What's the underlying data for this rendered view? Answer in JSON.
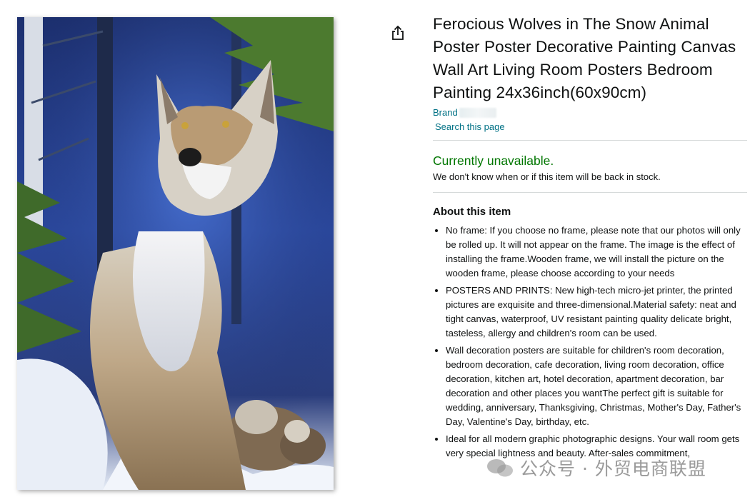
{
  "product": {
    "title": "Ferocious Wolves in The Snow Animal Poster Poster Decorative Painting Canvas Wall Art Living Room Posters Bedroom Painting 24x36inch(60x90cm)",
    "brand_label": "Brand",
    "search_link": "Search this page",
    "share_icon": "share-icon"
  },
  "availability": {
    "status": "Currently unavailable.",
    "note": "We don't know when or if this item will be back in stock.",
    "status_color": "#007600"
  },
  "about": {
    "heading": "About this item",
    "bullets": [
      "No frame: If you choose no frame, please note that our photos will only be rolled up. It will not appear on the frame. The image is the effect of installing the frame.Wooden frame, we will install the picture on the wooden frame, please choose according to your needs",
      "POSTERS AND PRINTS: New high-tech micro-jet printer, the printed pictures are exquisite and three-dimensional.Material safety: neat and tight canvas, waterproof, UV resistant painting quality delicate bright, tasteless, allergy and children's room can be used.",
      "Wall decoration posters are suitable for children's room decoration, bedroom decoration, cafe decoration, living room decoration, office decoration, kitchen art, hotel decoration, apartment decoration, bar decoration and other places you wantThe perfect gift is suitable for wedding, anniversary, Thanksgiving, Christmas, Mother's Day, Father's Day, Valentine's Day, birthday, etc.",
      "Ideal for all modern graphic photographic designs. Your wall room gets very special lightness and beauty. After-sales commitment,"
    ]
  },
  "watermark": {
    "text": "公众号 · 外贸电商联盟"
  },
  "colors": {
    "link": "#007185",
    "text": "#0f1111",
    "divider": "#d5d9d9"
  }
}
